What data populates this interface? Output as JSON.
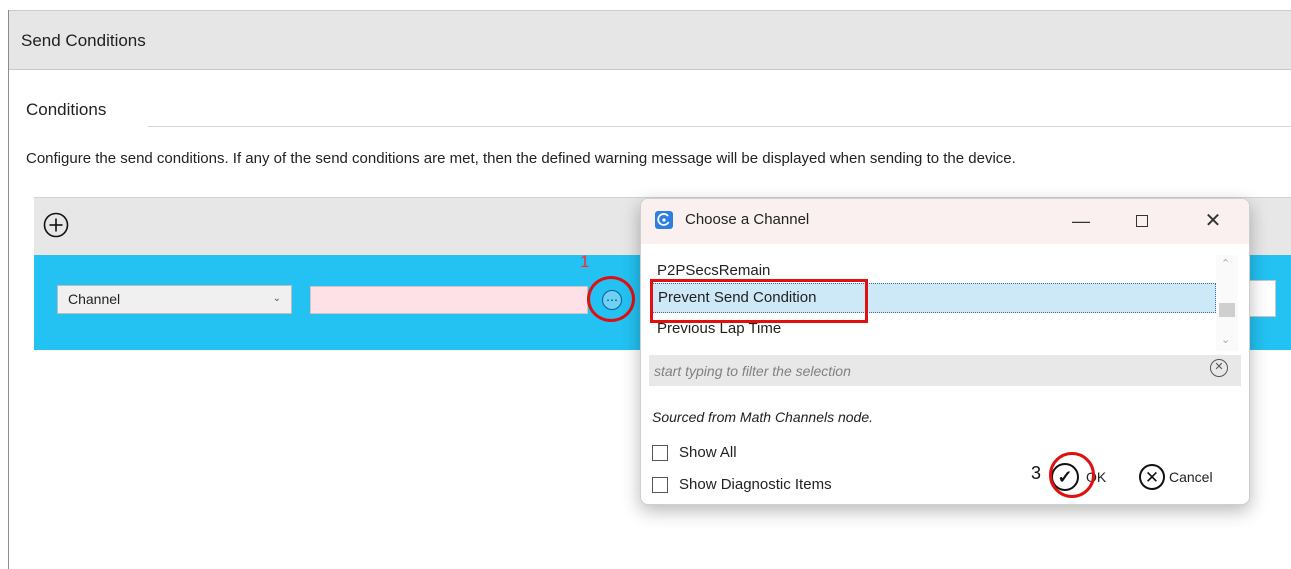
{
  "window": {
    "title": "Send Conditions"
  },
  "section": {
    "heading": "Conditions",
    "description": "Configure the send conditions. If any of the send conditions are met, then the defined warning message will be displayed when sending to the device."
  },
  "condition_row": {
    "type_select": "Channel",
    "value": ""
  },
  "annotations": {
    "marker_1": "1",
    "marker_3": "3",
    "highlight_color": "#e01010"
  },
  "dialog": {
    "title": "Choose a Channel",
    "list_items": [
      "P2PSecsRemain",
      "Prevent Send Condition",
      "Previous Lap Time"
    ],
    "selected_index": 1,
    "filter_placeholder": "start typing to filter the selection",
    "source_note": "Sourced from Math Channels node.",
    "checkboxes": [
      {
        "label": "Show All",
        "checked": false
      },
      {
        "label": "Show Diagnostic Items",
        "checked": false
      }
    ],
    "ok_label": "OK",
    "cancel_label": "Cancel"
  },
  "colors": {
    "row_accent": "#23c2f2",
    "invalid_field": "#fde1e6",
    "selection": "#cde8f7",
    "dialog_titlebar": "#fbf0f0"
  }
}
